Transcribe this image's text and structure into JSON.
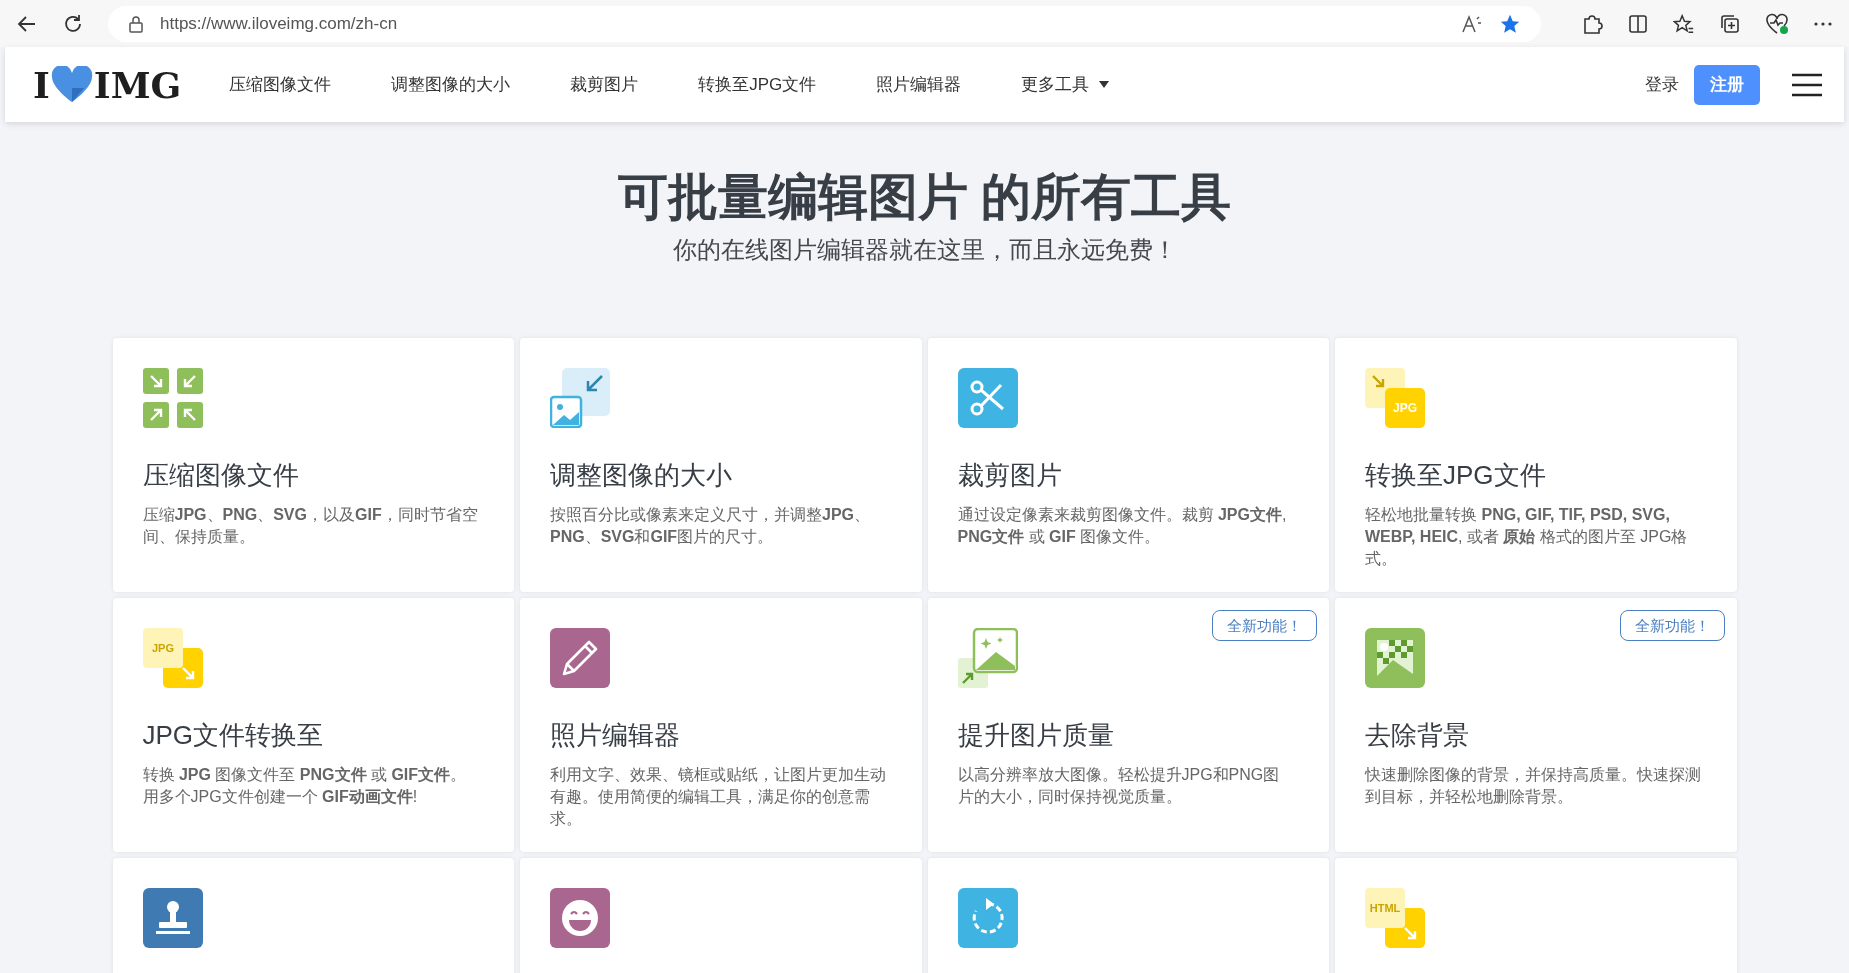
{
  "browser": {
    "url": "https://www.iloveimg.com/zh-cn"
  },
  "logo": {
    "left": "I",
    "right": "IMG"
  },
  "nav": [
    {
      "label": "压缩图像文件",
      "kind": "link"
    },
    {
      "label": "调整图像的大小",
      "kind": "link"
    },
    {
      "label": "裁剪图片",
      "kind": "link"
    },
    {
      "label": "转换至JPG文件",
      "kind": "link"
    },
    {
      "label": "照片编辑器",
      "kind": "link"
    },
    {
      "label": "更多工具",
      "kind": "dropdown"
    }
  ],
  "account": {
    "login": "登录",
    "signup": "注册"
  },
  "hero": {
    "title": "可批量编辑图片 的所有工具",
    "subtitle": "你的在线图片编辑器就在这里，而且永远免费！"
  },
  "tools": [
    {
      "kind": "compress",
      "title": "压缩图像文件",
      "description": "压缩**JPG**、**PNG**、**SVG**，以及**GIF**，同时节省空间、保持质量。"
    },
    {
      "kind": "resize",
      "title": "调整图像的大小",
      "description": "按照百分比或像素来定义尺寸，并调整**JPG**、**PNG**、**SVG**和**GIF**图片的尺寸。"
    },
    {
      "kind": "crop",
      "title": "裁剪图片",
      "description": "通过设定像素来裁剪图像文件。裁剪 **JPG文件**, **PNG文件** 或 **GIF** 图像文件。"
    },
    {
      "kind": "to-format",
      "icon_label": "JPG",
      "title": "转换至JPG文件",
      "description": "轻松地批量转换 **PNG, GIF, TIF, PSD, SVG, WEBP, HEIC**, 或者 **原始** 格式的图片至 JPG格式。"
    },
    {
      "kind": "from-format",
      "icon_label": "JPG",
      "title": "JPG文件转换至",
      "description": "转换 **JPG** 图像文件至 **PNG文件** 或 **GIF文件**。用多个JPG文件创建一个 **GIF动画文件**!"
    },
    {
      "kind": "editor",
      "title": "照片编辑器",
      "description": "利用文字、效果、镜框或贴纸，让图片更加生动有趣。使用简便的编辑工具，满足你的创意需求。"
    },
    {
      "kind": "upscale",
      "badge": "全新功能！",
      "title": "提升图片质量",
      "description": "以高分辨率放大图像。轻松提升JPG和PNG图片的大小，同时保持视觉质量。"
    },
    {
      "kind": "remove-bg",
      "badge": "全新功能！",
      "title": "去除背景",
      "description": "快速删除图像的背景，并保持高质量。快速探测到目标，并轻松地删除背景。"
    },
    {
      "kind": "watermark"
    },
    {
      "kind": "meme"
    },
    {
      "kind": "rotate"
    },
    {
      "kind": "from-format",
      "icon_label": "HTML"
    }
  ]
}
